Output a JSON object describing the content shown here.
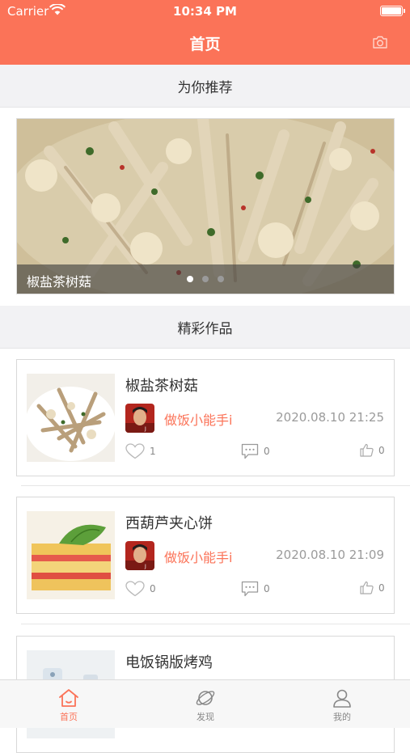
{
  "status_bar": {
    "carrier": "Carrier",
    "time": "10:34 PM"
  },
  "nav": {
    "title": "首页",
    "camera_icon": "camera-icon"
  },
  "recommend": {
    "header": "为你推荐",
    "banner_caption": "椒盐茶树菇",
    "page_count": 3,
    "active_page": 1
  },
  "works": {
    "header": "精彩作品",
    "items": [
      {
        "title": "椒盐茶树菇",
        "author": "做饭小能手i",
        "date": "2020.08.10 21:25",
        "likes": "1",
        "comments": "0",
        "thumbs": "0"
      },
      {
        "title": "西葫芦夹心饼",
        "author": "做饭小能手i",
        "date": "2020.08.10 21:09",
        "likes": "0",
        "comments": "0",
        "thumbs": "0"
      },
      {
        "title": "电饭锅版烤鸡"
      }
    ]
  },
  "tabs": [
    {
      "label": "首页",
      "icon": "home-icon",
      "active": true
    },
    {
      "label": "发现",
      "icon": "planet-icon",
      "active": false
    },
    {
      "label": "我的",
      "icon": "user-icon",
      "active": false
    }
  ],
  "colors": {
    "accent": "#fb7358",
    "muted": "#9b9b9b",
    "section_bg": "#f2f2f4"
  }
}
